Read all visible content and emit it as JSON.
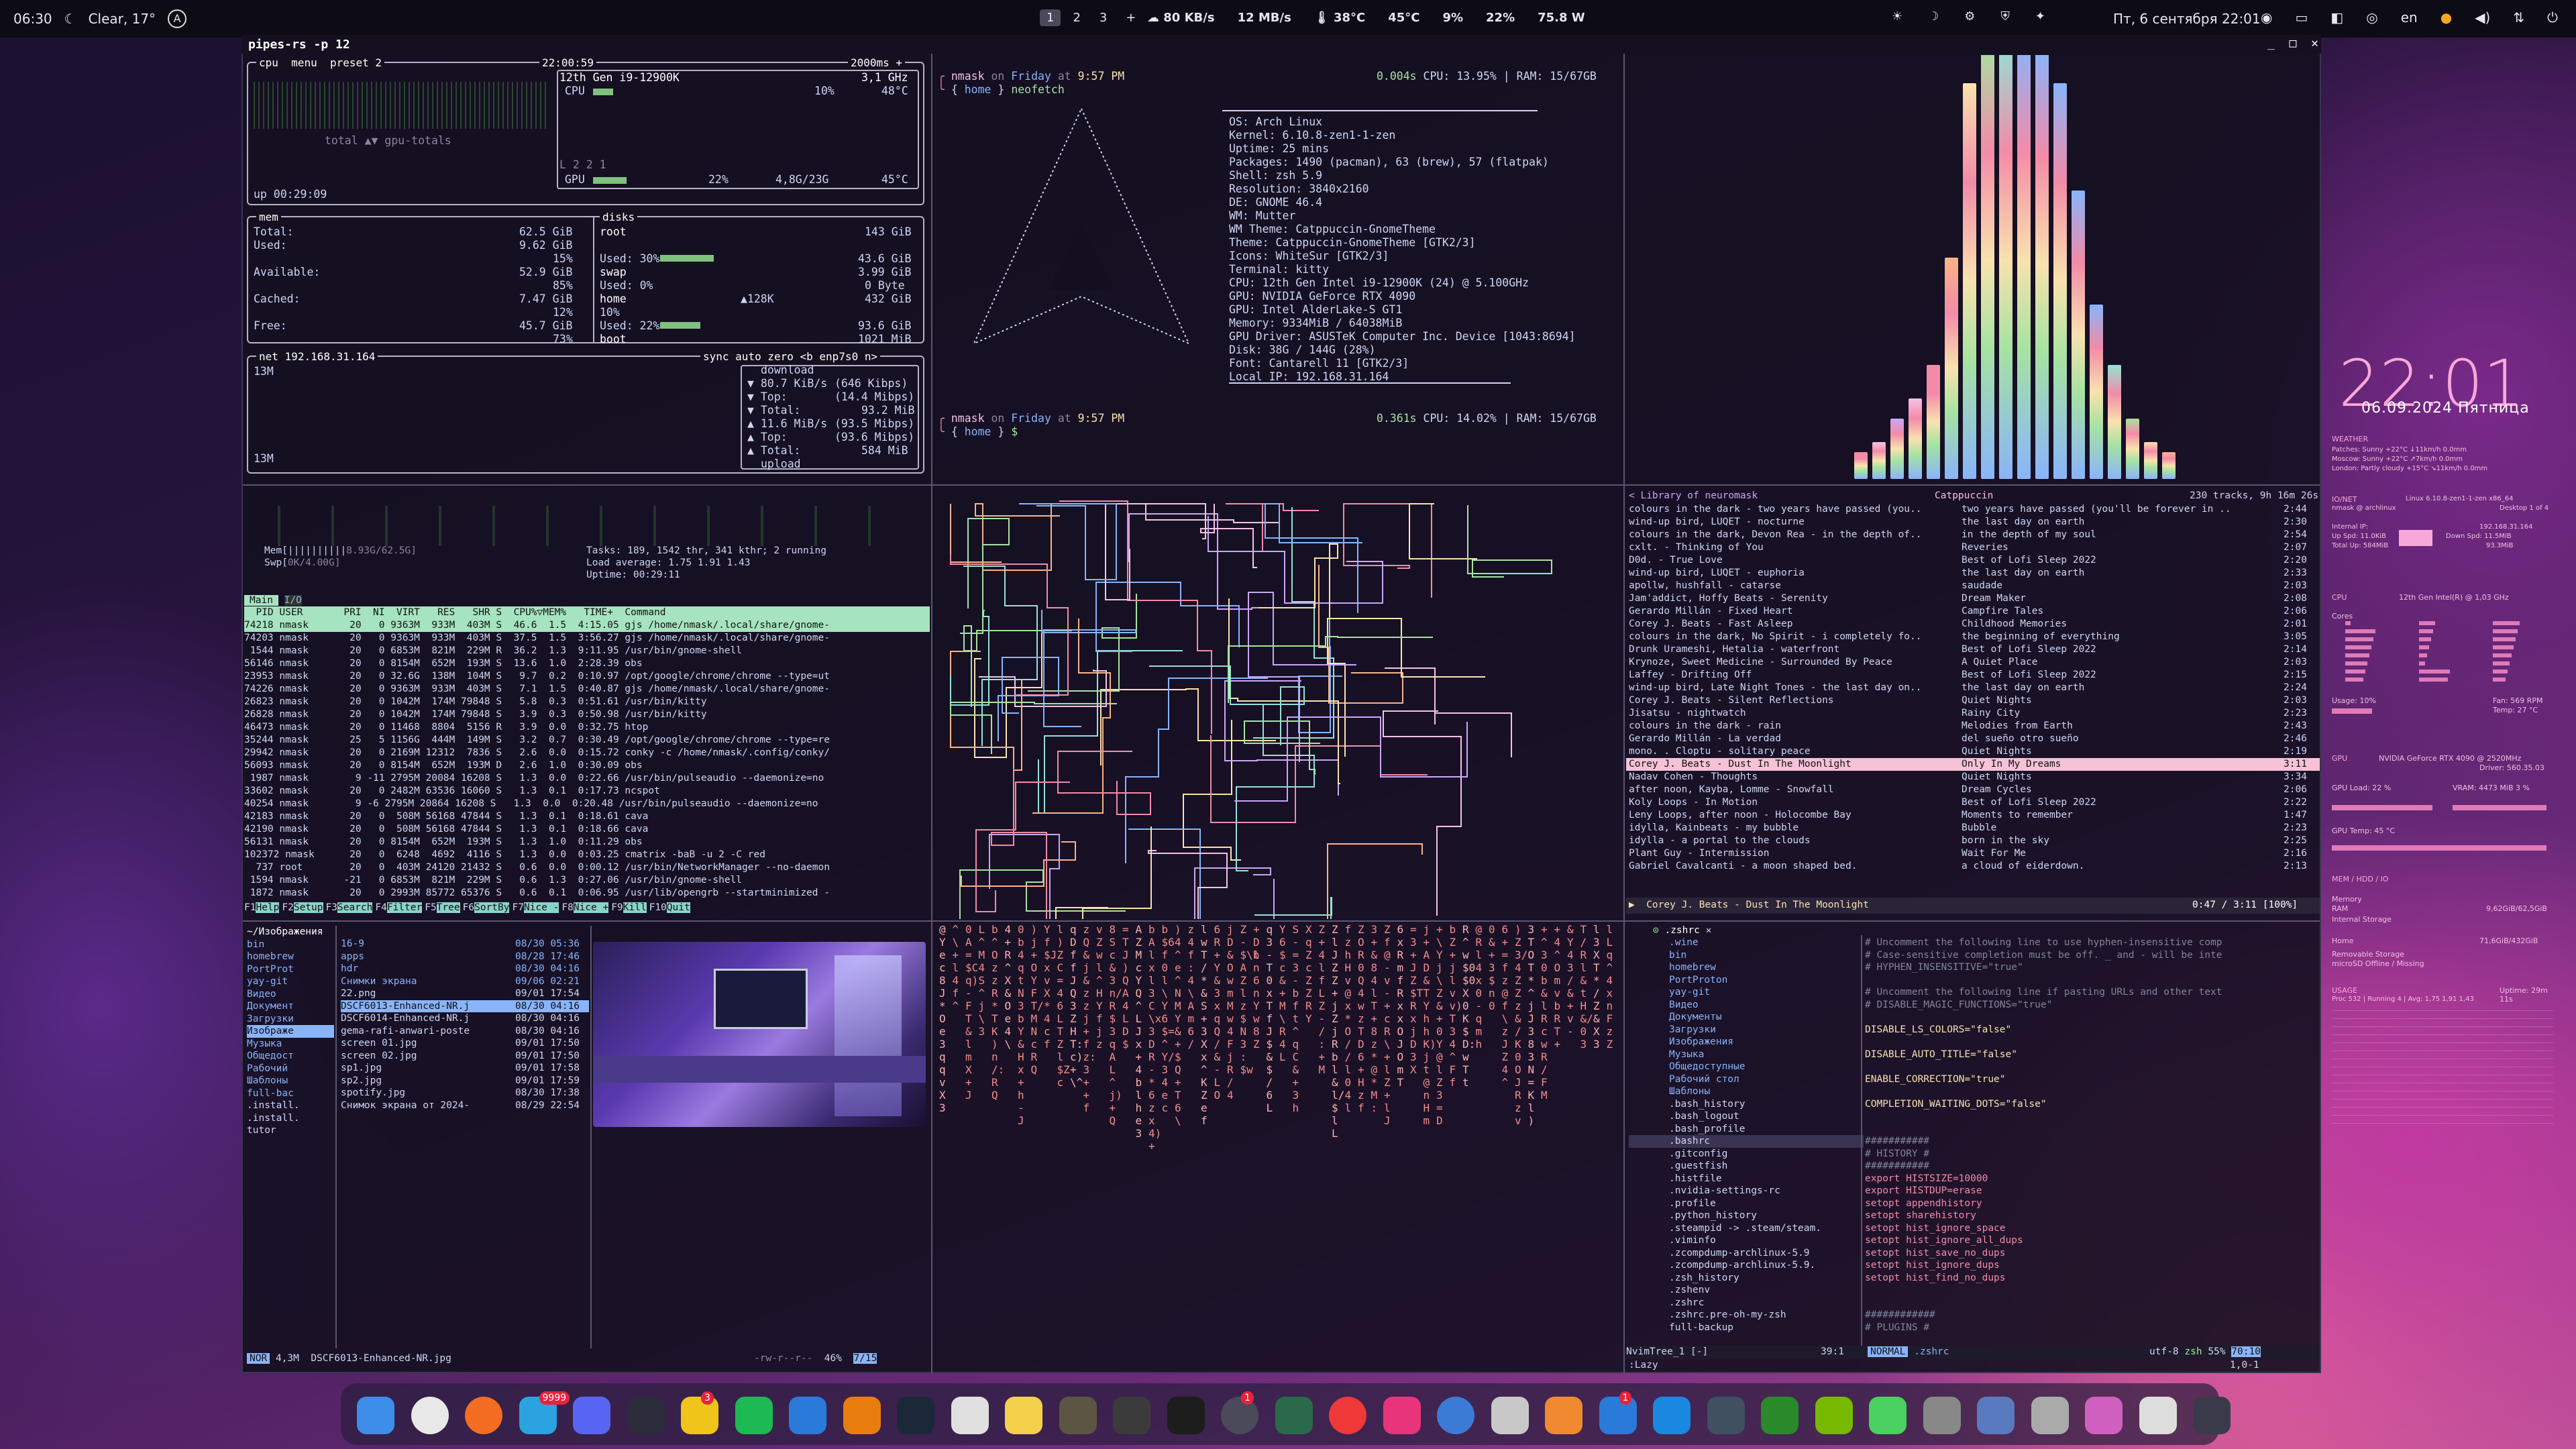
{
  "topbar": {
    "time": "06:30",
    "weather": "Clear, 17°",
    "workspaces": [
      "1",
      "2",
      "3",
      "+"
    ],
    "net_down": "80 KB/s",
    "net_up": "12 MB/s",
    "cpu_temp": "38°C",
    "gpu_temp": "45°C",
    "cpu_load": "9%",
    "mem": "22%",
    "power": "75.8 W",
    "date": "Пт, 6 сентября 22:01",
    "lang": "en"
  },
  "window": {
    "title": "pipes-rs -p 12"
  },
  "btop": {
    "cpu_label": "cpu",
    "menu_label": "menu",
    "preset": "preset 2",
    "clock": "22:00:59",
    "interval": "2000ms +",
    "cpu_model": "12th Gen i9-12900K",
    "freq": "3,1 GHz",
    "cpu_pct": "10%",
    "cpu_temp": "48°C",
    "gpu_label": "GPU",
    "gpu_pct": "22%",
    "gpu_mem": "4,8G/23G",
    "gpu_temp": "45°C",
    "load": "L 2 2 1",
    "uptime": "up 00:29:09",
    "total_label": "total ▲▼ gpu-totals",
    "mem": {
      "title": "mem",
      "total": "62.5 GiB",
      "used": "9.62 GiB",
      "used_pct": "15%",
      "available": "52.9 GiB",
      "avail_pct": "85%",
      "cached": "7.47 GiB",
      "cached_pct": "12%",
      "free": "45.7 GiB",
      "free_pct": "73%"
    },
    "disks": {
      "title": "disks",
      "root_size": "143 GiB",
      "root_used": "Used: 30%",
      "root_used_val": "43.6 GiB",
      "swap_size": "3.99 GiB",
      "swap_used": "Used: 0%",
      "swap_used_val": "0 Byte",
      "home_size": "432 GiB",
      "home_io": "▲128K",
      "home_used": "10%",
      "home_used2": "Used: 22%",
      "home_used_val": "93.6 GiB",
      "boot_size": "1021 MiB"
    },
    "net": {
      "title": "net",
      "ip": "192.168.31.164",
      "sync": "sync",
      "auto": "auto",
      "zero": "zero",
      "iface": "<b enp7s0 n>",
      "scale_top": "13M",
      "scale_bottom": "13M",
      "download": "download",
      "dl_rate": "80.7 KiB/s",
      "dl_rate2": "(646 Kibps)",
      "dl_top": "Top:",
      "dl_top_val": "(14.4 Mibps)",
      "dl_total": "Total:",
      "dl_total_val": "93.2 MiB",
      "ul_rate": "11.6 MiB/s",
      "ul_rate2": "(93.5 Mibps)",
      "ul_top": "Top:",
      "ul_top_val": "(93.6 Mibps)",
      "ul_total": "Total:",
      "ul_total_val": "584 MiB",
      "upload": "upload"
    }
  },
  "neofetch": {
    "prompt_user": "nmask",
    "prompt_on": "on",
    "prompt_day": "Friday",
    "prompt_at": "at",
    "prompt_time": "9:57 PM",
    "prompt_dur": "0.004s",
    "prompt_cpu": "CPU: 13.95%",
    "prompt_ram": "RAM: 15/67GB",
    "cmd": "neofetch",
    "path": "home",
    "os": "OS: Arch Linux",
    "kernel": "Kernel: 6.10.8-zen1-1-zen",
    "uptime": "Uptime: 25 mins",
    "packages": "Packages: 1490 (pacman), 63 (brew), 57 (flatpak)",
    "shell": "Shell: zsh 5.9",
    "resolution": "Resolution: 3840x2160",
    "de": "DE: GNOME 46.4",
    "wm": "WM: Mutter",
    "wm_theme": "WM Theme: Catppuccin-GnomeTheme",
    "theme": "Theme: Catppuccin-GnomeTheme [GTK2/3]",
    "icons": "Icons: WhiteSur [GTK2/3]",
    "terminal": "Terminal: kitty",
    "cpu": "CPU: 12th Gen Intel i9-12900K (24) @ 5.100GHz",
    "gpu1": "GPU: NVIDIA GeForce RTX 4090",
    "gpu2": "GPU: Intel AlderLake-S GT1",
    "memory": "Memory: 9334MiB / 64038MiB",
    "gpu_driver": "GPU Driver: ASUSTeK Computer Inc. Device [1043:8694]",
    "disk": "Disk: 38G / 144G (28%)",
    "font": "Font: Cantarell 11 [GTK2/3]",
    "local_ip": "Local IP: 192.168.31.164",
    "prompt2_dur": "0.361s",
    "prompt2_cpu": "CPU: 14.02%",
    "prompt2_ram": "RAM: 15/67GB"
  },
  "htop": {
    "tasks": "Tasks: 189, 1542 thr, 341 kthr; 2 running",
    "load": "Load average: 1.75 1.91 1.43",
    "uptime": "Uptime: 00:29:11",
    "mem_lbl": "Mem[||||||||||",
    "mem_val": "8.93G/62.5G]",
    "swp_lbl": "Swp[",
    "swp_val": "0K/4.00G]",
    "tabs": [
      "Main",
      "I/O"
    ],
    "header": "  PID USER       PRI  NI  VIRT   RES   SHR S  CPU%▽MEM%   TIME+  Command",
    "rows": [
      "74218 nmask       20   0 9363M  933M  403M S  46.6  1.5  4:15.05 gjs /home/nmask/.local/share/gnome-",
      "74203 nmask       20   0 9363M  933M  403M S  37.5  1.5  3:56.27 gjs /home/nmask/.local/share/gnome-",
      " 1544 nmask       20   0 6853M  821M  229M R  36.2  1.3  9:11.95 /usr/bin/gnome-shell",
      "56146 nmask       20   0 8154M  652M  193M S  13.6  1.0  2:28.39 obs",
      "23953 nmask       20   0 32.6G  138M  104M S   9.7  0.2  0:10.97 /opt/google/chrome/chrome --type=ut",
      "74226 nmask       20   0 9363M  933M  403M S   7.1  1.5  0:40.87 gjs /home/nmask/.local/share/gnome-",
      "26823 nmask       20   0 1042M  174M 79848 S   5.8  0.3  0:51.61 /usr/bin/kitty",
      "26828 nmask       20   0 1042M  174M 79848 S   3.9  0.3  0:50.98 /usr/bin/kitty",
      "46473 nmask       20   0 11468  8804  5156 R   3.9  0.0  0:32.75 htop",
      "35244 nmask       25   5 1156G  444M  149M S   3.2  0.7  0:30.49 /opt/google/chrome/chrome --type=re",
      "29942 nmask       20   0 2169M 12312  7836 S   2.6  0.0  0:15.72 conky -c /home/nmask/.config/conky/",
      "56093 nmask       20   0 8154M  652M  193M D   2.6  1.0  0:30.09 obs",
      " 1987 nmask        9 -11 2795M 20084 16208 S   1.3  0.0  0:22.66 /usr/bin/pulseaudio --daemonize=no",
      "33602 nmask       20   0 2482M 63536 16060 S   1.3  0.1  0:17.73 ncspot",
      "40254 nmask        9 -6 2795M 20864 16208 S   1.3  0.0  0:20.48 /usr/bin/pulseaudio --daemonize=no",
      "42183 nmask       20   0  508M 56168 47844 S   1.3  0.1  0:18.61 cava",
      "42190 nmask       20   0  508M 56168 47844 S   1.3  0.1  0:18.66 cava",
      "56131 nmask       20   0 8154M  652M  193M S   1.3  1.0  0:11.29 obs",
      "102372 nmask      20   0  6248  4692  4116 S   1.3  0.0  0:03.25 cmatrix -baB -u 2 -C red",
      "  737 root        20   0  403M 24120 21432 S   0.6  0.0  0:00.12 /usr/bin/NetworkManager --no-daemon",
      " 1594 nmask      -21   0 6853M  821M  229M S   0.6  1.3  0:27.06 /usr/bin/gnome-shell",
      " 1872 nmask       20   0 2993M 85772 65376 S   0.6  0.1  0:06.95 /usr/lib/opengrb --startminimized -"
    ],
    "fkeys": [
      [
        "F1",
        "Help"
      ],
      [
        "F2",
        "Setup"
      ],
      [
        "F3",
        "Search"
      ],
      [
        "F4",
        "Filter"
      ],
      [
        "F5",
        "Tree"
      ],
      [
        "F6",
        "SortBy"
      ],
      [
        "F7",
        "Nice -"
      ],
      [
        "F8",
        "Nice +"
      ],
      [
        "F9",
        "Kill"
      ],
      [
        "F10",
        "Quit"
      ]
    ]
  },
  "ncspot": {
    "library": "< Library of neuromask",
    "playlist": "Catppuccin",
    "tracks": "230 tracks, 9h 16m 26s",
    "rows": [
      [
        "colours in the dark - two years have passed (you..",
        "two years have passed (you'll be forever in ..",
        "2:44"
      ],
      [
        "wind-up bird, LUQET - nocturne",
        "the last day on earth",
        "2:30"
      ],
      [
        "colours in the dark, Devon Rea - in the depth of..",
        "in the depth of my soul",
        "2:54"
      ],
      [
        "cxlt. - Thinking of You",
        "Reveries",
        "2:07"
      ],
      [
        "D0d. - True Love",
        "Best of Lofi Sleep 2022",
        "2:20"
      ],
      [
        "wind-up bird, LUQET - euphoria",
        "the last day on earth",
        "2:33"
      ],
      [
        "apollw, hushfall - catarse",
        "saudade",
        "2:03"
      ],
      [
        "Jam'addict, Hoffy Beats - Serenity",
        "Dream Maker",
        "2:08"
      ],
      [
        "Gerardo Millán - Fixed Heart",
        "Campfire Tales",
        "2:06"
      ],
      [
        "Corey J. Beats - Fast Asleep",
        "Childhood Memories",
        "2:01"
      ],
      [
        "colours in the dark, No Spirit - i completely fo..",
        "the beginning of everything",
        "3:05"
      ],
      [
        "Drunk Urameshi, Hetalia - waterfront",
        "Best of Lofi Sleep 2022",
        "2:14"
      ],
      [
        "Krynoze, Sweet Medicine - Surrounded By Peace",
        "A Quiet Place",
        "2:03"
      ],
      [
        "Laffey - Drifting Off",
        "Best of Lofi Sleep 2022",
        "2:15"
      ],
      [
        "wind-up bird, Late Night Tones - the last day on..",
        "the last day on earth",
        "2:24"
      ],
      [
        "Corey J. Beats - Silent Reflections",
        "Quiet Nights",
        "2:03"
      ],
      [
        "Jisatsu - nightwatch",
        "Rainy City",
        "2:23"
      ],
      [
        "colours in the dark - rain",
        "Melodies from Earth",
        "2:43"
      ],
      [
        "Gerardo Millán - La verdad",
        "del sueño otro sueño",
        "2:46"
      ],
      [
        "mono. . Cloptu - solitary peace",
        "Quiet Nights",
        "2:19"
      ],
      [
        "Corey J. Beats - Dust In The Moonlight",
        "Only In My Dreams",
        "3:11"
      ],
      [
        "Nadav Cohen - Thoughts",
        "Quiet Nights",
        "3:34"
      ],
      [
        "after noon, Kayba, Lomme - Snowfall",
        "Dream Cycles",
        "2:06"
      ],
      [
        "Koly Loops - In Motion",
        "Best of Lofi Sleep 2022",
        "2:22"
      ],
      [
        "Leny Loops, after noon - Holocombe Bay",
        "Moments to remember",
        "1:47"
      ],
      [
        "idylla, Kainbeats - my bubble",
        "Bubble",
        "2:23"
      ],
      [
        "idylla - a portal to the clouds",
        "born in the sky",
        "2:25"
      ],
      [
        "Plant Guy - Intermission",
        "Wait For Me",
        "2:16"
      ],
      [
        "Gabriel Cavalcanti - a moon shaped bed.",
        "a cloud of eiderdown.",
        "2:13"
      ]
    ],
    "now_playing": "▶  Corey J. Beats - Dust In The Moonlight",
    "progress": "0:47 / 3:11 [100%]"
  },
  "files": {
    "parent": [
      "~/Изображения",
      "bin",
      "homebrew",
      "PortProt",
      "yay-git",
      "Видео",
      "Документ",
      "Загрузки",
      "Изображе",
      "Музыка",
      "Общедост",
      "Рабочий",
      "Шаблоны",
      "full-bac",
      ".install.",
      ".install.",
      "tutor"
    ],
    "items": [
      [
        "16-9",
        "08/30 05:36"
      ],
      [
        "apps",
        "08/28 17:46"
      ],
      [
        "hdr",
        "08/30 04:16"
      ],
      [
        "Снимки экрана",
        "09/06 02:21"
      ],
      [
        "22.png",
        "09/01 17:54"
      ],
      [
        "DSCF6013-Enhanced-NR.j",
        "08/30 04:16"
      ],
      [
        "DSCF6014-Enhanced-NR.j",
        "08/30 04:16"
      ],
      [
        "gema-rafi-anwari-poste",
        "08/30 04:16"
      ],
      [
        "screen 01.jpg",
        "09/01 17:50"
      ],
      [
        "screen 02.jpg",
        "09/01 17:50"
      ],
      [
        "sp1.jpg",
        "09/01 17:58"
      ],
      [
        "sp2.jpg",
        "09/01 17:59"
      ],
      [
        "spotify.jpg",
        "08/30 17:38"
      ],
      [
        "Снимок экрана от 2024-",
        "08/29 22:54"
      ]
    ],
    "mode": "NOR",
    "size": "4,3M",
    "selected": "DSCF6013-Enhanced-NR.jpg",
    "perms": "-rw-r--r--",
    "pct": "46%",
    "pos": "7/15"
  },
  "nvim": {
    "tab": ".zshrc",
    "tree": [
      ".wine",
      "bin",
      "homebrew",
      "PortProton",
      "yay-git",
      "Видео",
      "Документы",
      "Загрузки",
      "Изображения",
      "Музыка",
      "Общедоступные",
      "Рабочий стол",
      "Шаблоны",
      ".bash_history",
      ".bash_logout",
      ".bash_profile",
      ".bashrc",
      ".gitconfig",
      ".guestfish",
      ".histfile",
      ".nvidia-settings-rc",
      ".profile",
      ".python_history",
      ".steampid -> .steam/steam.",
      ".viminfo",
      ".zcompdump-archlinux-5.9",
      ".zcompdump-archlinux-5.9.",
      ".zsh_history",
      ".zshenv",
      ".zshrc",
      ".zshrc.pre-oh-my-zsh",
      "full-backup"
    ],
    "code": [
      "# Uncomment the following line to use hyphen-insensitive comp",
      "# Case-sensitive completion must be off. _ and - will be inte",
      "# HYPHEN_INSENSITIVE=\"true\"",
      "",
      "# Uncomment the following line if pasting URLs and other text",
      "# DISABLE_MAGIC_FUNCTIONS=\"true\"",
      "",
      "DISABLE_LS_COLORS=\"false\"",
      "",
      "DISABLE_AUTO_TITLE=\"false\"",
      "",
      "ENABLE_CORRECTION=\"true\"",
      "",
      "COMPLETION_WAITING_DOTS=\"false\"",
      "",
      "",
      "###########",
      "# HISTORY #",
      "###########",
      "export HISTSIZE=10000",
      "export HISTDUP=erase",
      "setopt appendhistory",
      "setopt sharehistory",
      "setopt hist_ignore_space",
      "setopt hist_ignore_all_dups",
      "setopt hist_save_no_dups",
      "setopt hist_ignore_dups",
      "setopt hist_find_no_dups",
      "",
      "",
      "############",
      "# PLUGINS #"
    ],
    "status_left": "NvimTree_1 [-]",
    "status_pos": "39:1",
    "mode": "NORMAL",
    "file": ".zshrc",
    "encoding": "utf-8",
    "shell": "zsh",
    "pct": "55%",
    "linecol": "70:10",
    "lazy": ":Lazy",
    "bottom_pos": "1,0-1"
  },
  "conky": {
    "time": "22:01",
    "date": "06.09.2024 Пятница",
    "weather_title": "WEATHER",
    "weather_lines": [
      "Patches: Sunny +22°C ↓11km/h 0.0mm",
      "Moscow: Sunny +22°C ↗7km/h 0.0mm",
      "London: Partly cloudy +15°C ↘11km/h 0.0mm"
    ],
    "io_title": "IO/NET",
    "os": "Linux  6.10.8-zen1-1-zen x86_64",
    "host": "nmask @ archlinux",
    "desktop": "Desktop 1 of 4",
    "internal_ip": "Internal IP:",
    "ip": "192.168.31.164",
    "up_spd": "Up Spd:",
    "up_val": "11.0KiB",
    "down_spd": "Down Spd:",
    "down_val": "11.5MiB",
    "total_up": "Total Up:",
    "total_up_val": "584MiB",
    "total_down": "93.3MiB",
    "cpu_title": "CPU",
    "cpu_model": "12th Gen Intel(R) @ 1,03 GHz",
    "cores": "Cores",
    "usage": "Usage: 10%",
    "fan": "Fan: 569 RPM",
    "temp": "Temp: 27 °C",
    "gpu_title": "GPU",
    "gpu_model": "NVIDIA GeForce RTX 4090 @ 2520MHz",
    "driver": "Driver: 560.35.03",
    "gpu_load": "GPU Load: 22 %",
    "vram": "VRAM: 4473 MiB 3 %",
    "gpu_temp": "GPU Temp: 45 °C",
    "mem_title": "MEM / HDD / IO",
    "memory": "Memory",
    "ram": "RAM",
    "ram_val": "9,62GiB/62,5GiB",
    "internal_storage": "Internal Storage",
    "home": "Home",
    "home_val": "71,6GiB/432GiB",
    "removable": "Removable Storage",
    "micro": "microSD Offline / Missing",
    "usage_title": "USAGE",
    "usage_line": "Proc 532 | Running 4 | Avg: 1,75 1,91 1,43",
    "uptime": "Uptime: 29m 11s"
  },
  "matrix_cols": "Tm3&+z\\3 )03 :+/- xNq D  @ 8^0l-AhC3$ RKR zZew4 Z4+ zx  f ^n+*6/bO^ j ltF  Hv   4&f M l=  X  RS ZOJ/YQT $  &b ZcY$ jL",
  "dock": {
    "telegram_badge": "9999",
    "app4_badge": "3",
    "app16_badge": "1",
    "app23_badge": "1"
  }
}
